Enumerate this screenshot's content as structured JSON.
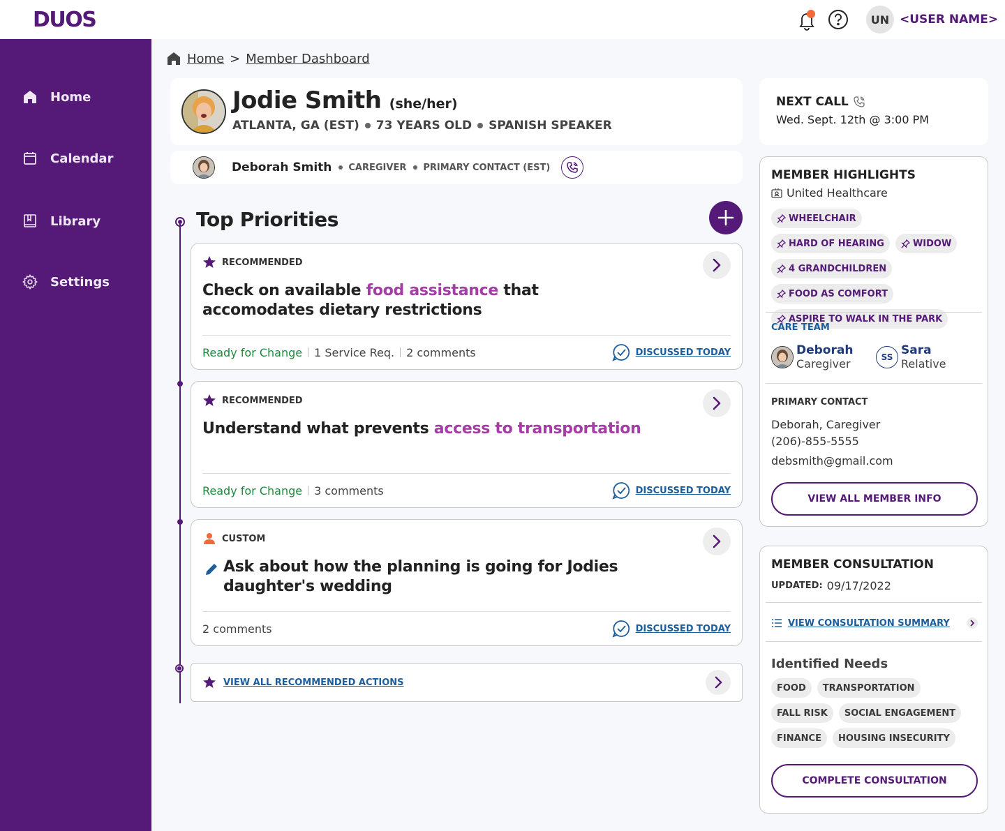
{
  "app": {
    "logo": "DUOS",
    "user_initials": "UN",
    "user_name": "<USER NAME>"
  },
  "nav": {
    "home": "Home",
    "calendar": "Calendar",
    "library": "Library",
    "settings": "Settings"
  },
  "breadcrumb": {
    "home": "Home",
    "separator": ">",
    "current": "Member Dashboard"
  },
  "member": {
    "name": "Jodie Smith",
    "pronouns": "(she/her)",
    "location": "ATLANTA, GA (EST)",
    "age": "73 YEARS OLD",
    "language": "SPANISH SPEAKER"
  },
  "contact": {
    "name": "Deborah Smith",
    "role": "CAREGIVER",
    "type": "PRIMARY CONTACT (EST)"
  },
  "top_priorities": {
    "title": "Top Priorities",
    "cards": [
      {
        "tag": "RECOMMENDED",
        "text_before": "Check on available ",
        "highlight": "food assistance",
        "text_after": " that accomodates dietary restrictions",
        "status": "Ready for Change",
        "service": "1 Service Req.",
        "comments": "2 comments",
        "discussed": "DISCUSSED TODAY"
      },
      {
        "tag": "RECOMMENDED",
        "text_before": "Understand what prevents ",
        "highlight": "access to transportation",
        "status": "Ready for Change",
        "comments": "3 comments",
        "discussed": "DISCUSSED TODAY"
      },
      {
        "tag": "CUSTOM",
        "text": "Ask about how the planning is going for Jodies daughter's wedding",
        "comments": "2 comments",
        "discussed": "DISCUSSED TODAY"
      }
    ],
    "view_all": "VIEW ALL RECOMMENDED ACTIONS"
  },
  "next_call": {
    "label": "NEXT CALL",
    "time": "Wed. Sept. 12th @ 3:00 PM"
  },
  "highlights": {
    "title": "MEMBER HIGHLIGHTS",
    "insurer": "United Healthcare",
    "chips": [
      "WHEELCHAIR",
      "HARD OF HEARING",
      "WIDOW",
      "4 GRANDCHILDREN",
      "FOOD AS COMFORT",
      "ASPIRE TO WALK IN THE PARK"
    ],
    "care_team_label": "CARE TEAM",
    "care_team": [
      {
        "name": "Deborah",
        "role": "Caregiver"
      },
      {
        "initials": "SS",
        "name": "Sara",
        "role": "Relative"
      }
    ],
    "primary_contact_label": "PRIMARY CONTACT",
    "primary_contact_name": "Deborah, Caregiver",
    "primary_contact_phone": "(206)-855-5555",
    "primary_contact_email": "debsmith@gmail.com",
    "view_all_button": "VIEW ALL MEMBER INFO"
  },
  "consultation": {
    "title": "MEMBER CONSULTATION",
    "updated_label": "UPDATED:",
    "updated_date": "09/17/2022",
    "summary_link": "VIEW CONSULTATION SUMMARY",
    "needs_title": "Identified Needs",
    "needs": [
      "FOOD",
      "TRANSPORTATION",
      "FALL RISK",
      "SOCIAL ENGAGEMENT",
      "FINANCE",
      "HOUSING INSECURITY"
    ],
    "complete_button": "COMPLETE CONSULTATION"
  },
  "colors": {
    "brand": "#551a77",
    "highlight": "#a43ea6",
    "ready": "#1e8a3c",
    "link": "#1c5d9c",
    "notification": "#f26a3a"
  }
}
